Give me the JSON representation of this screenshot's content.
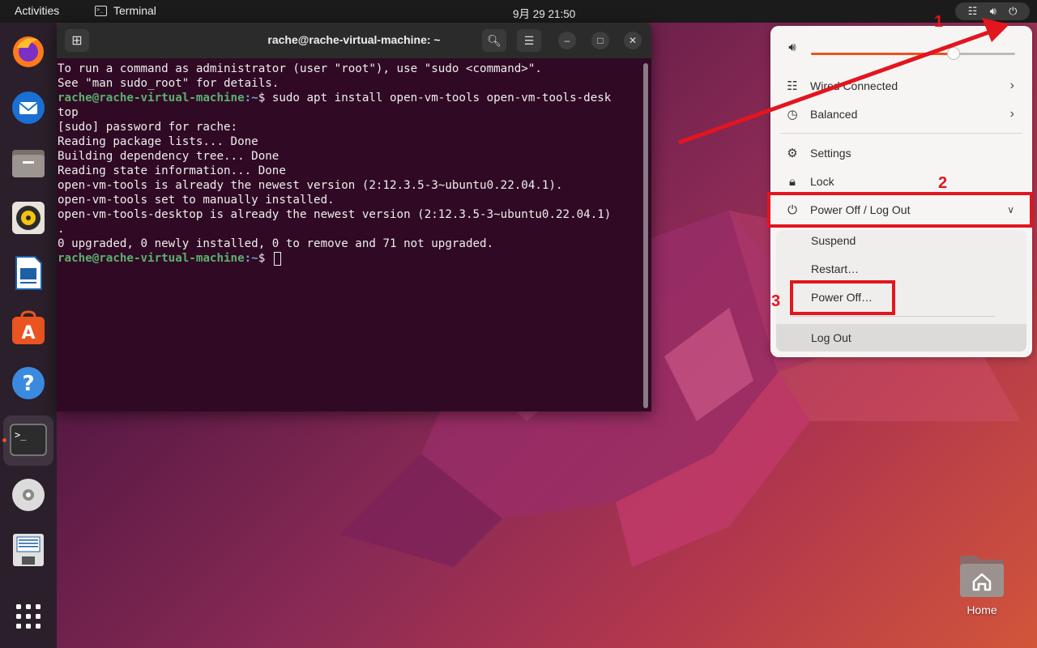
{
  "topbar": {
    "activities": "Activities",
    "app_name": "Terminal",
    "clock": "9月 29  21:50"
  },
  "dock": {
    "items": [
      "firefox-icon",
      "thunderbird-icon",
      "files-icon",
      "rhythmbox-icon",
      "libreoffice-writer-icon",
      "app-center-icon",
      "help-icon",
      "terminal-icon",
      "optical-disc-icon",
      "save-drive-icon",
      "show-apps-icon"
    ]
  },
  "terminal": {
    "title": "rache@rache-virtual-machine: ~",
    "lines": [
      "To run a command as administrator (user \"root\"), use \"sudo <command>\".",
      "See \"man sudo_root\" for details.",
      "",
      "",
      "top",
      "[sudo] password for rache:",
      "Reading package lists... Done",
      "Building dependency tree... Done",
      "Reading state information... Done",
      "open-vm-tools is already the newest version (2:12.3.5-3~ubuntu0.22.04.1).",
      "open-vm-tools set to manually installed.",
      "open-vm-tools-desktop is already the newest version (2:12.3.5-3~ubuntu0.22.04.1)",
      ".",
      "0 upgraded, 0 newly installed, 0 to remove and 71 not upgraded."
    ],
    "prompt_user": "rache@rache-virtual-machine",
    "prompt_path": ":~",
    "prompt_sign": "$ ",
    "command": "sudo apt install open-vm-tools open-vm-tools-desk"
  },
  "system_menu": {
    "volume_level": 0.7,
    "accent_color": "#e95420",
    "items": {
      "network": "Wired Connected",
      "power_mode": "Balanced",
      "settings": "Settings",
      "lock": "Lock",
      "power_off_logout": "Power Off / Log Out"
    },
    "submenu": {
      "suspend": "Suspend",
      "restart": "Restart…",
      "power_off": "Power Off…",
      "log_out": "Log Out"
    }
  },
  "annotations": {
    "n1": "1",
    "n2": "2",
    "n3": "3",
    "color": "#e3151e"
  },
  "desktop": {
    "home_label": "Home"
  }
}
